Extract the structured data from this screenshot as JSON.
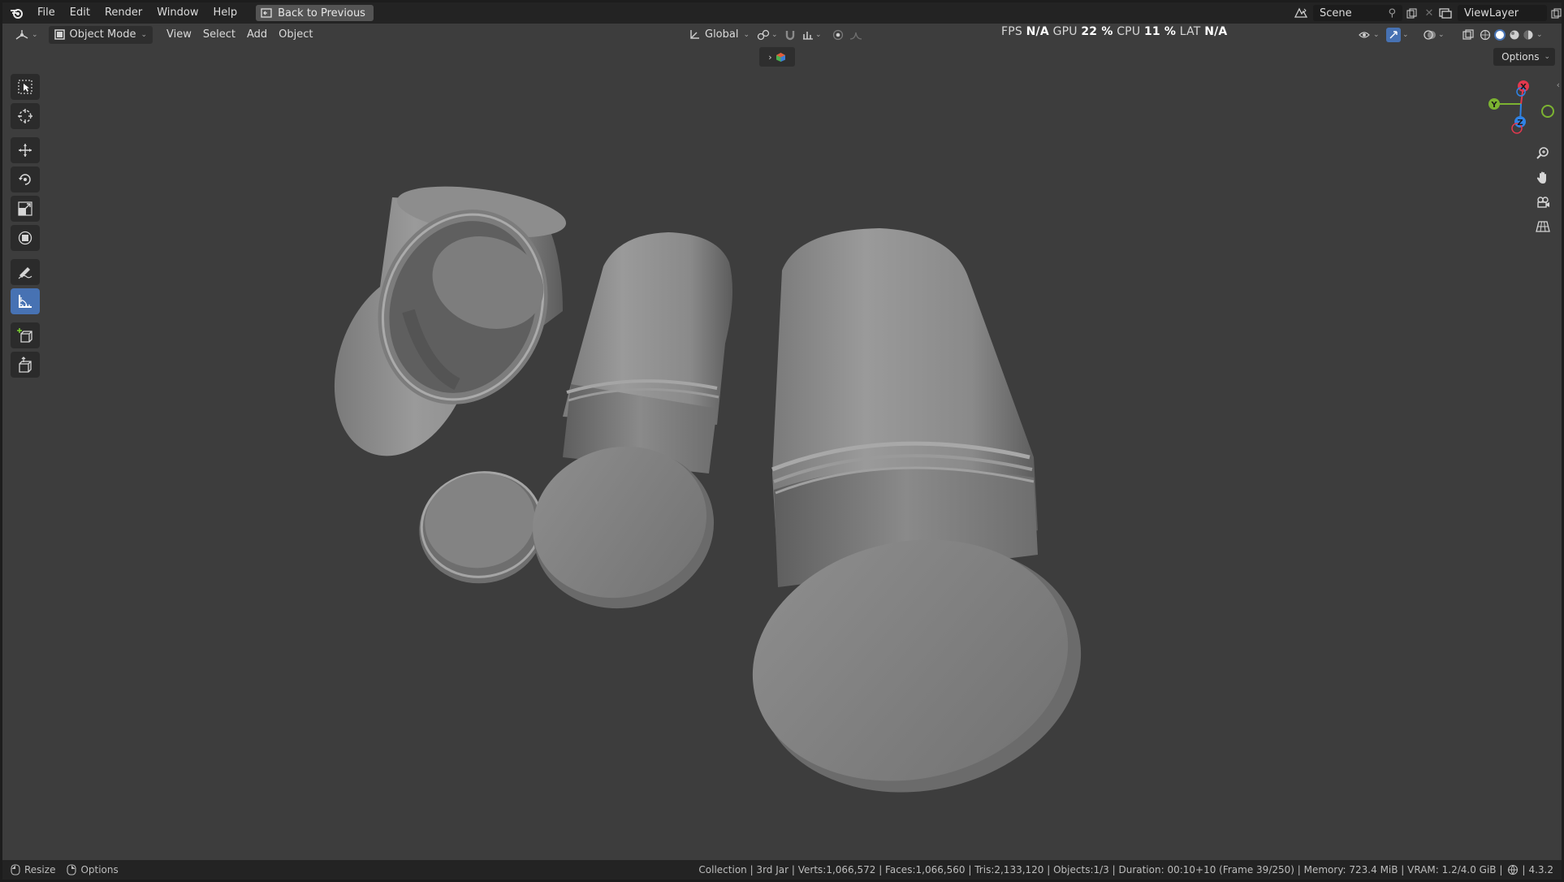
{
  "menu": {
    "items": [
      "File",
      "Edit",
      "Render",
      "Window",
      "Help"
    ],
    "back_button": "Back to Previous"
  },
  "scene": {
    "name": "Scene"
  },
  "view_layer": {
    "name": "ViewLayer"
  },
  "header": {
    "mode": "Object Mode",
    "menus": [
      "View",
      "Select",
      "Add",
      "Object"
    ],
    "orientation": "Global"
  },
  "perf": {
    "fps_label": "FPS",
    "fps_value": "N/A",
    "gpu_label": "GPU",
    "gpu_value": "22 %",
    "cpu_label": "CPU",
    "cpu_value": "11 %",
    "lat_label": "LAT",
    "lat_value": "N/A"
  },
  "viewport": {
    "options_label": "Options",
    "gizmo": {
      "x": "X",
      "y": "Y",
      "z": "Z"
    }
  },
  "status": {
    "resize": "Resize",
    "options": "Options",
    "info": "Collection | 3rd Jar | Verts:1,066,572 | Faces:1,066,560 | Tris:2,133,120 | Objects:1/3 | Duration: 00:10+10 (Frame 39/250) | Memory: 723.4 MiB | VRAM: 1.2/4.0 GiB |",
    "version": "4.3.2"
  },
  "colors": {
    "viewport_bg": "#3d3d3d",
    "bar_bg": "#232323",
    "accent": "#4772b3",
    "axis_x": "#e2384e",
    "axis_y": "#7cb331",
    "axis_z": "#2f83e6"
  }
}
